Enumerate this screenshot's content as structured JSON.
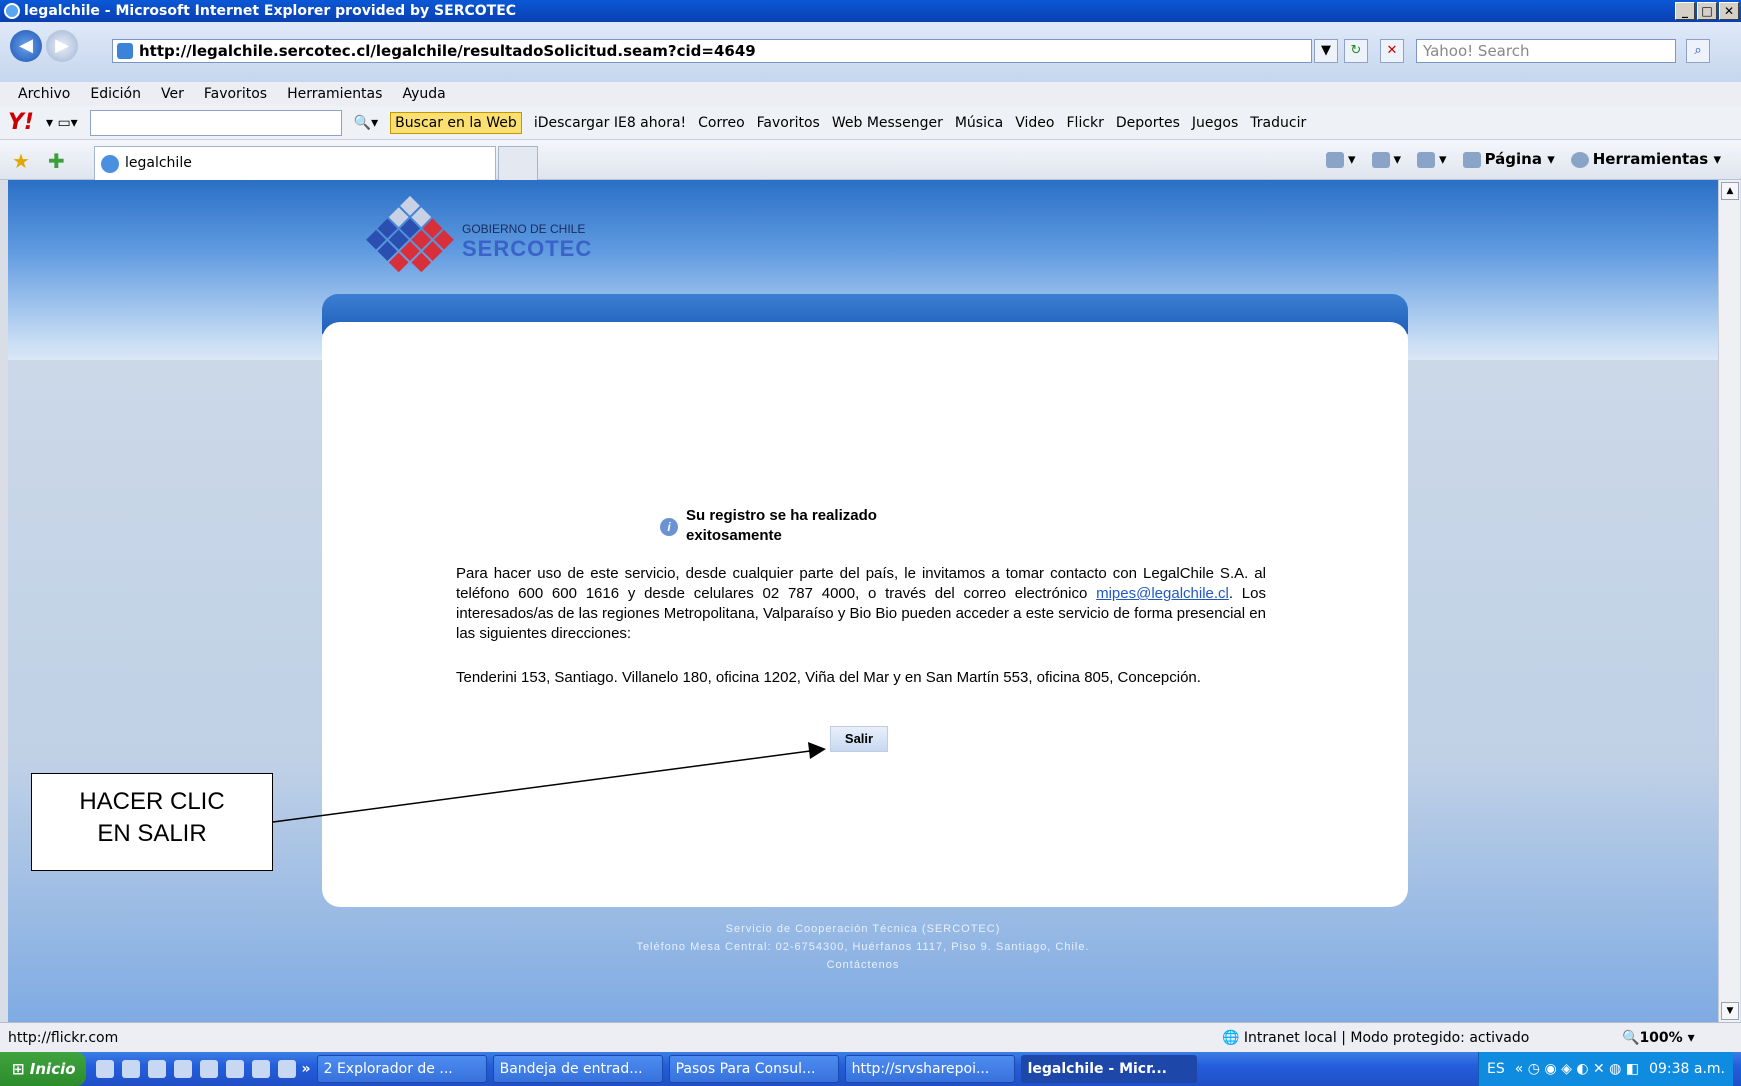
{
  "window": {
    "title": "legalchile - Microsoft Internet Explorer provided by SERCOTEC"
  },
  "address": {
    "url": "http://legalchile.sercotec.cl/legalchile/resultadoSolicitud.seam?cid=4649",
    "search_placeholder": "Yahoo! Search"
  },
  "menu": [
    "Archivo",
    "Edición",
    "Ver",
    "Favoritos",
    "Herramientas",
    "Ayuda"
  ],
  "yahoo_toolbar": {
    "search_button": "Buscar en la Web",
    "items": [
      "iDescargar IE8 ahora!",
      "Correo",
      "Favoritos",
      "Web Messenger",
      "Música",
      "Video",
      "Flickr",
      "Deportes",
      "Juegos",
      "Traducir"
    ]
  },
  "tabs": {
    "active": "legalchile"
  },
  "command_bar": {
    "page": "Página",
    "tools": "Herramientas"
  },
  "page": {
    "logo_top": "GOBIERNO DE CHILE",
    "logo_main": "SERCOTEC",
    "message_line1": "Su registro se ha realizado",
    "message_line2": "exitosamente",
    "body_pre": "Para hacer uso de este servicio, desde cualquier parte del país, le invitamos a tomar contacto con LegalChile S.A. al teléfono 600 600 1616 y desde celulares 02 787 4000, o través del correo electrónico ",
    "email": "mipes@legalchile.cl",
    "body_post": ". Los interesados/as de las regiones Metropolitana, Valparaíso y Bio Bio pueden acceder a este servicio de forma presencial en las siguientes direcciones:",
    "address": "Tenderini 153, Santiago. Villanelo 180, oficina 1202, Viña del Mar y en San Martín 553, oficina 805, Concepción.",
    "exit_button": "Salir",
    "footer1": "Servicio de Cooperación Técnica (SERCOTEC)",
    "footer2": "Teléfono Mesa Central: 02-6754300, Huérfanos 1117, Piso 9. Santiago, Chile.",
    "footer3": "Contáctenos"
  },
  "callout": {
    "line1": "HACER CLIC",
    "line2": "EN SALIR"
  },
  "status": {
    "url": "http://flickr.com",
    "zone": "Intranet local | Modo protegido: activado",
    "zoom": "100%"
  },
  "taskbar": {
    "start": "Inicio",
    "tasks": [
      "2 Explorador de ...",
      "Bandeja de entrad...",
      "Pasos Para Consul...",
      "http://srvsharepoi...",
      "legalchile - Micr..."
    ],
    "lang": "ES",
    "time": "09:38 a.m."
  }
}
